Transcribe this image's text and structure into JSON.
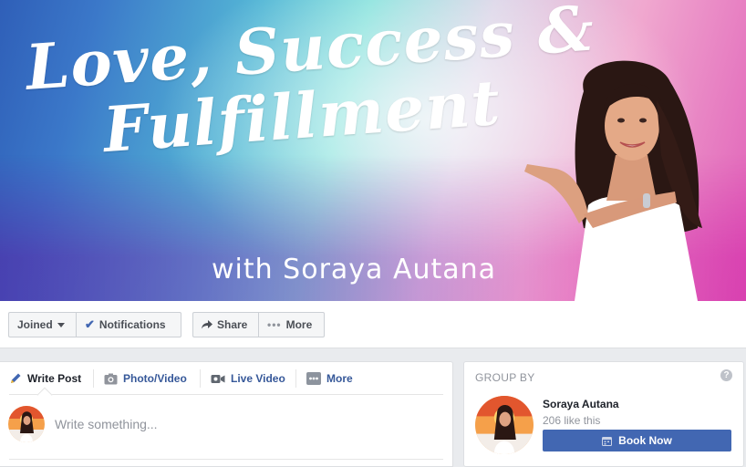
{
  "cover": {
    "title_line1": "Love, Success &",
    "title_line2": "Fulfillment",
    "subtitle": "with Soraya Autana"
  },
  "actions": {
    "joined": "Joined",
    "notifications": "Notifications",
    "share": "Share",
    "more": "More"
  },
  "composer": {
    "tabs": [
      {
        "label": "Write Post",
        "icon": "pencil-icon"
      },
      {
        "label": "Photo/Video",
        "icon": "photo-icon"
      },
      {
        "label": "Live Video",
        "icon": "video-camera-icon"
      },
      {
        "label": "More",
        "icon": "more-icon"
      }
    ],
    "placeholder": "Write something..."
  },
  "group_by": {
    "heading": "GROUP BY",
    "owner_name": "Soraya Autana",
    "likes": "206 like this",
    "book_button": "Book Now"
  },
  "colors": {
    "brand_blue": "#4267b2",
    "link_blue": "#365899",
    "page_bg": "#e9ebee"
  }
}
